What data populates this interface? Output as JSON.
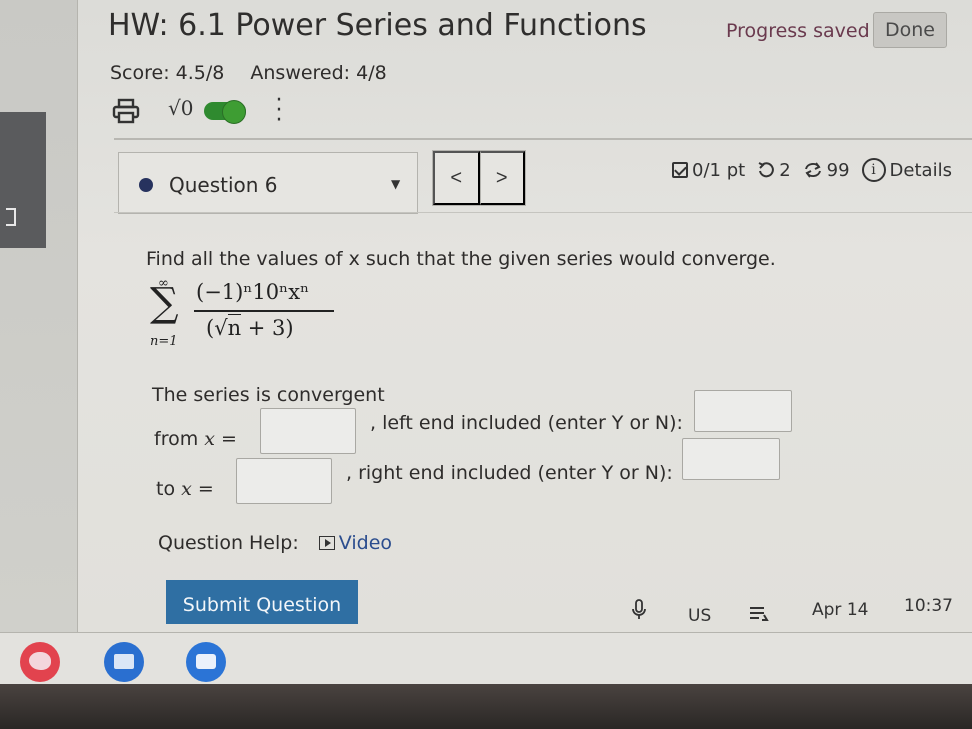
{
  "header": {
    "title": "HW: 6.1 Power Series and Functions",
    "progress_text": "Progress saved",
    "done_label": "Done"
  },
  "status": {
    "score": "Score: 4.5/8",
    "answered": "Answered: 4/8"
  },
  "tools": {
    "sqrt_label": "√0"
  },
  "question_nav": {
    "selected": "Question 6",
    "prev_label": "<",
    "next_label": ">",
    "points": "0/1 pt",
    "attempts": "2",
    "retries": "99",
    "details_label": "Details"
  },
  "question": {
    "prompt": "Find all the values of x such that the given series would converge.",
    "formula": {
      "upper": "∞",
      "lower": "n=1",
      "numerator": "(−1)ⁿ10ⁿxⁿ",
      "denominator_root": "n",
      "denominator_rest": " + 3)"
    },
    "convergent_label": "The series is convergent",
    "from_label": "from",
    "to_label": "to",
    "x_eq": "x =",
    "left_end_label": ", left end included (enter Y or N):",
    "right_end_label": ", right end included (enter Y or N):",
    "from_value": "",
    "left_value": "",
    "to_value": "",
    "right_value": "",
    "help_label": "Question Help:",
    "video_label": "Video",
    "submit_label": "Submit Question"
  },
  "shelf": {
    "locale": "US",
    "date": "Apr 14",
    "time": "10:37"
  },
  "colors": {
    "progress": "#6a3a4e",
    "submit": "#2f6fa3",
    "toggle": "#2f8a2f",
    "link": "#2b4d8e"
  }
}
